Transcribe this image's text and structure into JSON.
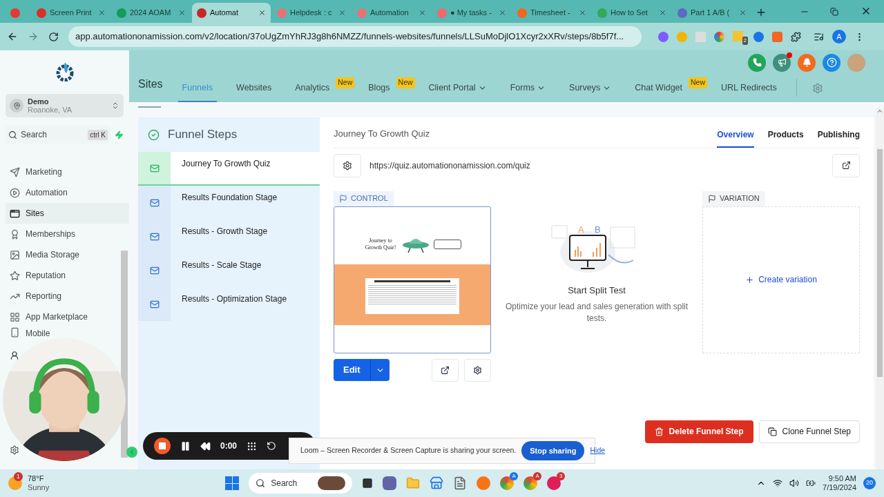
{
  "browser": {
    "tabs": [
      {
        "selected": false
      },
      {
        "title": "Screen Print",
        "selected": false
      },
      {
        "title": "2024 AOAM",
        "selected": false
      },
      {
        "title": "Automat",
        "selected": true
      },
      {
        "title": "Helpdesk : c",
        "selected": false
      },
      {
        "title": "Automation",
        "selected": false
      },
      {
        "title": "● My tasks -",
        "selected": false
      },
      {
        "title": "Timesheet -",
        "selected": false
      },
      {
        "title": "How to Set",
        "selected": false
      },
      {
        "title": "Part 1 A/B (",
        "selected": false
      }
    ],
    "url": "app.automationonamission.com/v2/location/37oUgZmYhRJ3g8h6NMZZ/funnels-websites/funnels/LLSuMoDjlO1Xcyr2xXRv/steps/8b5f7f...",
    "extension_badge": "2",
    "profile_initial": "A"
  },
  "sidebar": {
    "account": {
      "name": "Demo",
      "location": "Roanoke, VA"
    },
    "search": {
      "placeholder": "Search",
      "shortcut": "ctrl K"
    },
    "items": [
      {
        "label": "Marketing",
        "selected": false
      },
      {
        "label": "Automation",
        "selected": false
      },
      {
        "label": "Sites",
        "selected": true
      },
      {
        "label": "Memberships",
        "selected": false
      },
      {
        "label": "Media Storage",
        "selected": false
      },
      {
        "label": "Reputation",
        "selected": false
      },
      {
        "label": "Reporting",
        "selected": false
      },
      {
        "label": "App Marketplace",
        "selected": false
      },
      {
        "label": "Mobile",
        "selected": false
      }
    ]
  },
  "topnav": {
    "title": "Sites",
    "tabs": [
      {
        "label": "Funnels",
        "selected": true,
        "dropdown": false
      },
      {
        "label": "Websites",
        "selected": false,
        "dropdown": false
      },
      {
        "label": "Analytics",
        "selected": false,
        "dropdown": false,
        "badge": "New"
      },
      {
        "label": "Blogs",
        "selected": false,
        "dropdown": false,
        "badge": "New"
      },
      {
        "label": "Client Portal",
        "selected": false,
        "dropdown": true
      },
      {
        "label": "Forms",
        "selected": false,
        "dropdown": true
      },
      {
        "label": "Surveys",
        "selected": false,
        "dropdown": true
      },
      {
        "label": "Chat Widget",
        "selected": false,
        "dropdown": false,
        "badge": "New"
      },
      {
        "label": "URL Redirects",
        "selected": false,
        "dropdown": false
      }
    ]
  },
  "funnel": {
    "title": "Funnel Steps",
    "steps": [
      {
        "name": "Journey To Growth Quiz",
        "selected": true
      },
      {
        "name": "Results Foundation Stage",
        "selected": false
      },
      {
        "name": "Results - Growth Stage",
        "selected": false
      },
      {
        "name": "Results - Scale Stage",
        "selected": false
      },
      {
        "name": "Results - Optimization Stage",
        "selected": false
      }
    ]
  },
  "step": {
    "title": "Journey To Growth Quiz",
    "tabs": [
      {
        "label": "Overview",
        "selected": true
      },
      {
        "label": "Products",
        "selected": false
      },
      {
        "label": "Publishing",
        "selected": false
      }
    ],
    "url": "https://quiz.automationonamission.com/quiz",
    "control_label": "CONTROL",
    "preview": {
      "title": "Journey to Growth Quiz!"
    },
    "illustration_labels": [
      "A",
      "B"
    ],
    "edit_button": "Edit",
    "split_title": "Start Split Test",
    "split_text": "Optimize your lead and sales generation with split tests.",
    "variation_label": "VARIATION",
    "create_variation": "Create variation",
    "delete_button": "Delete Funnel Step",
    "clone_button": "Clone Funnel Step"
  },
  "loom": {
    "time": "0:00",
    "notice": "Loom – Screen Recorder & Screen Capture is sharing your screen.",
    "stop_button": "Stop sharing",
    "hide_link": "Hide"
  },
  "taskbar": {
    "weather_badge": "1",
    "temperature": "78°F",
    "condition": "Sunny",
    "search": "Search",
    "app_badges": [
      "A",
      "A",
      "3"
    ],
    "time": "9:50 AM",
    "date": "7/19/2024",
    "notifications": "20"
  }
}
